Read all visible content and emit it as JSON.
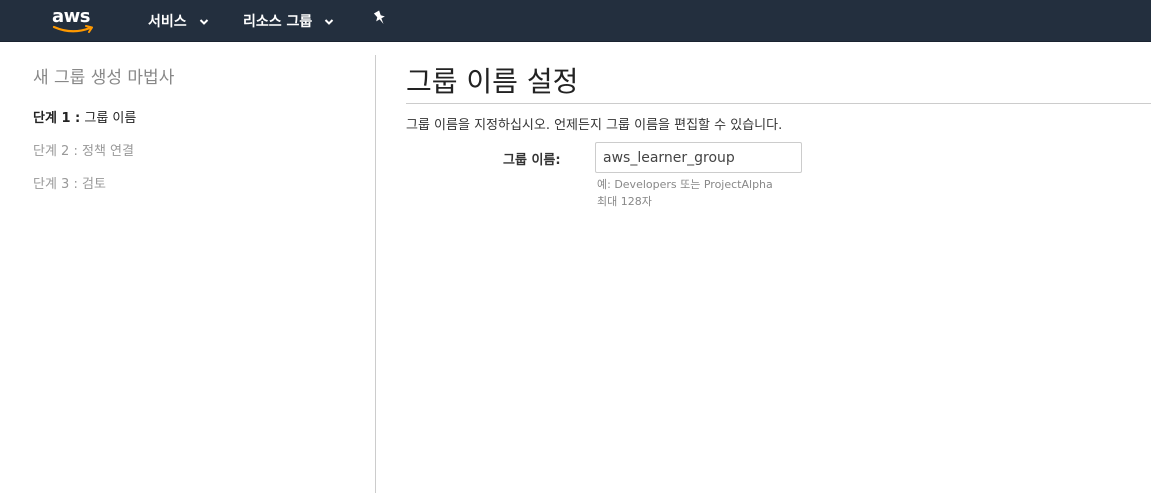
{
  "topbar": {
    "logo_text": "aws",
    "nav": [
      {
        "label": "서비스"
      },
      {
        "label": "리소스 그룹"
      }
    ],
    "icons": {
      "pin": "pin-icon",
      "chevron": "chevron-down-icon",
      "smile": "aws-smile-icon"
    },
    "colors": {
      "background": "#232f3e",
      "text": "#ffffff",
      "smile": "#ff9900"
    }
  },
  "sidebar": {
    "title": "새 그룹 생성 마법사",
    "steps": [
      {
        "num": "단계 1 :",
        "label": "그룹 이름",
        "active": true
      },
      {
        "num": "단계 2 :",
        "label": "정책 연결",
        "active": false
      },
      {
        "num": "단계 3 :",
        "label": "검토",
        "active": false
      }
    ]
  },
  "main": {
    "title": "그룹 이름 설정",
    "description": "그룹 이름을 지정하십시오. 언제든지 그룹 이름을 편집할 수 있습니다.",
    "field": {
      "label": "그룹 이름:",
      "value": "aws_learner_group",
      "hint_example": "예: Developers 또는 ProjectAlpha",
      "hint_max": "최대 128자"
    }
  }
}
